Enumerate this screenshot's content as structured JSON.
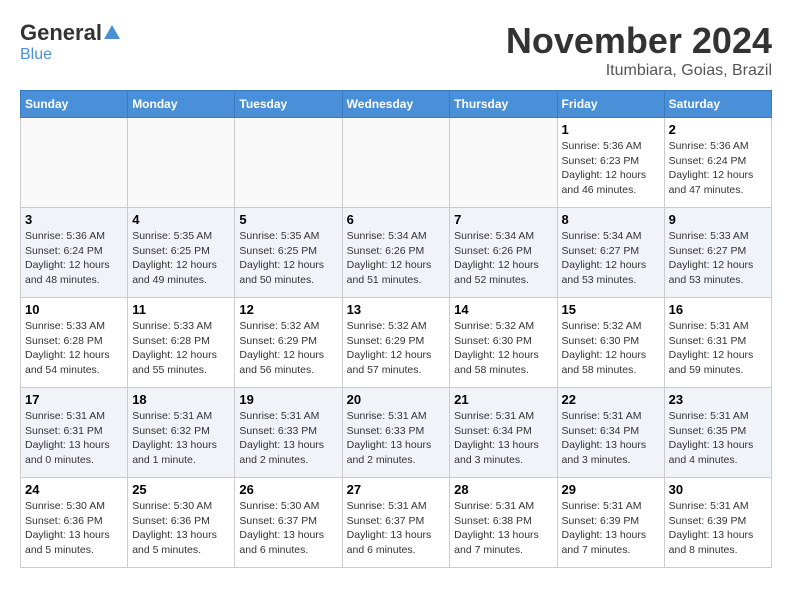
{
  "header": {
    "logo_general": "General",
    "logo_blue": "Blue",
    "month_title": "November 2024",
    "location": "Itumbiara, Goias, Brazil"
  },
  "days_of_week": [
    "Sunday",
    "Monday",
    "Tuesday",
    "Wednesday",
    "Thursday",
    "Friday",
    "Saturday"
  ],
  "weeks": [
    [
      {
        "day": "",
        "info": ""
      },
      {
        "day": "",
        "info": ""
      },
      {
        "day": "",
        "info": ""
      },
      {
        "day": "",
        "info": ""
      },
      {
        "day": "",
        "info": ""
      },
      {
        "day": "1",
        "info": "Sunrise: 5:36 AM\nSunset: 6:23 PM\nDaylight: 12 hours\nand 46 minutes."
      },
      {
        "day": "2",
        "info": "Sunrise: 5:36 AM\nSunset: 6:24 PM\nDaylight: 12 hours\nand 47 minutes."
      }
    ],
    [
      {
        "day": "3",
        "info": "Sunrise: 5:36 AM\nSunset: 6:24 PM\nDaylight: 12 hours\nand 48 minutes."
      },
      {
        "day": "4",
        "info": "Sunrise: 5:35 AM\nSunset: 6:25 PM\nDaylight: 12 hours\nand 49 minutes."
      },
      {
        "day": "5",
        "info": "Sunrise: 5:35 AM\nSunset: 6:25 PM\nDaylight: 12 hours\nand 50 minutes."
      },
      {
        "day": "6",
        "info": "Sunrise: 5:34 AM\nSunset: 6:26 PM\nDaylight: 12 hours\nand 51 minutes."
      },
      {
        "day": "7",
        "info": "Sunrise: 5:34 AM\nSunset: 6:26 PM\nDaylight: 12 hours\nand 52 minutes."
      },
      {
        "day": "8",
        "info": "Sunrise: 5:34 AM\nSunset: 6:27 PM\nDaylight: 12 hours\nand 53 minutes."
      },
      {
        "day": "9",
        "info": "Sunrise: 5:33 AM\nSunset: 6:27 PM\nDaylight: 12 hours\nand 53 minutes."
      }
    ],
    [
      {
        "day": "10",
        "info": "Sunrise: 5:33 AM\nSunset: 6:28 PM\nDaylight: 12 hours\nand 54 minutes."
      },
      {
        "day": "11",
        "info": "Sunrise: 5:33 AM\nSunset: 6:28 PM\nDaylight: 12 hours\nand 55 minutes."
      },
      {
        "day": "12",
        "info": "Sunrise: 5:32 AM\nSunset: 6:29 PM\nDaylight: 12 hours\nand 56 minutes."
      },
      {
        "day": "13",
        "info": "Sunrise: 5:32 AM\nSunset: 6:29 PM\nDaylight: 12 hours\nand 57 minutes."
      },
      {
        "day": "14",
        "info": "Sunrise: 5:32 AM\nSunset: 6:30 PM\nDaylight: 12 hours\nand 58 minutes."
      },
      {
        "day": "15",
        "info": "Sunrise: 5:32 AM\nSunset: 6:30 PM\nDaylight: 12 hours\nand 58 minutes."
      },
      {
        "day": "16",
        "info": "Sunrise: 5:31 AM\nSunset: 6:31 PM\nDaylight: 12 hours\nand 59 minutes."
      }
    ],
    [
      {
        "day": "17",
        "info": "Sunrise: 5:31 AM\nSunset: 6:31 PM\nDaylight: 13 hours\nand 0 minutes."
      },
      {
        "day": "18",
        "info": "Sunrise: 5:31 AM\nSunset: 6:32 PM\nDaylight: 13 hours\nand 1 minute."
      },
      {
        "day": "19",
        "info": "Sunrise: 5:31 AM\nSunset: 6:33 PM\nDaylight: 13 hours\nand 2 minutes."
      },
      {
        "day": "20",
        "info": "Sunrise: 5:31 AM\nSunset: 6:33 PM\nDaylight: 13 hours\nand 2 minutes."
      },
      {
        "day": "21",
        "info": "Sunrise: 5:31 AM\nSunset: 6:34 PM\nDaylight: 13 hours\nand 3 minutes."
      },
      {
        "day": "22",
        "info": "Sunrise: 5:31 AM\nSunset: 6:34 PM\nDaylight: 13 hours\nand 3 minutes."
      },
      {
        "day": "23",
        "info": "Sunrise: 5:31 AM\nSunset: 6:35 PM\nDaylight: 13 hours\nand 4 minutes."
      }
    ],
    [
      {
        "day": "24",
        "info": "Sunrise: 5:30 AM\nSunset: 6:36 PM\nDaylight: 13 hours\nand 5 minutes."
      },
      {
        "day": "25",
        "info": "Sunrise: 5:30 AM\nSunset: 6:36 PM\nDaylight: 13 hours\nand 5 minutes."
      },
      {
        "day": "26",
        "info": "Sunrise: 5:30 AM\nSunset: 6:37 PM\nDaylight: 13 hours\nand 6 minutes."
      },
      {
        "day": "27",
        "info": "Sunrise: 5:31 AM\nSunset: 6:37 PM\nDaylight: 13 hours\nand 6 minutes."
      },
      {
        "day": "28",
        "info": "Sunrise: 5:31 AM\nSunset: 6:38 PM\nDaylight: 13 hours\nand 7 minutes."
      },
      {
        "day": "29",
        "info": "Sunrise: 5:31 AM\nSunset: 6:39 PM\nDaylight: 13 hours\nand 7 minutes."
      },
      {
        "day": "30",
        "info": "Sunrise: 5:31 AM\nSunset: 6:39 PM\nDaylight: 13 hours\nand 8 minutes."
      }
    ]
  ]
}
